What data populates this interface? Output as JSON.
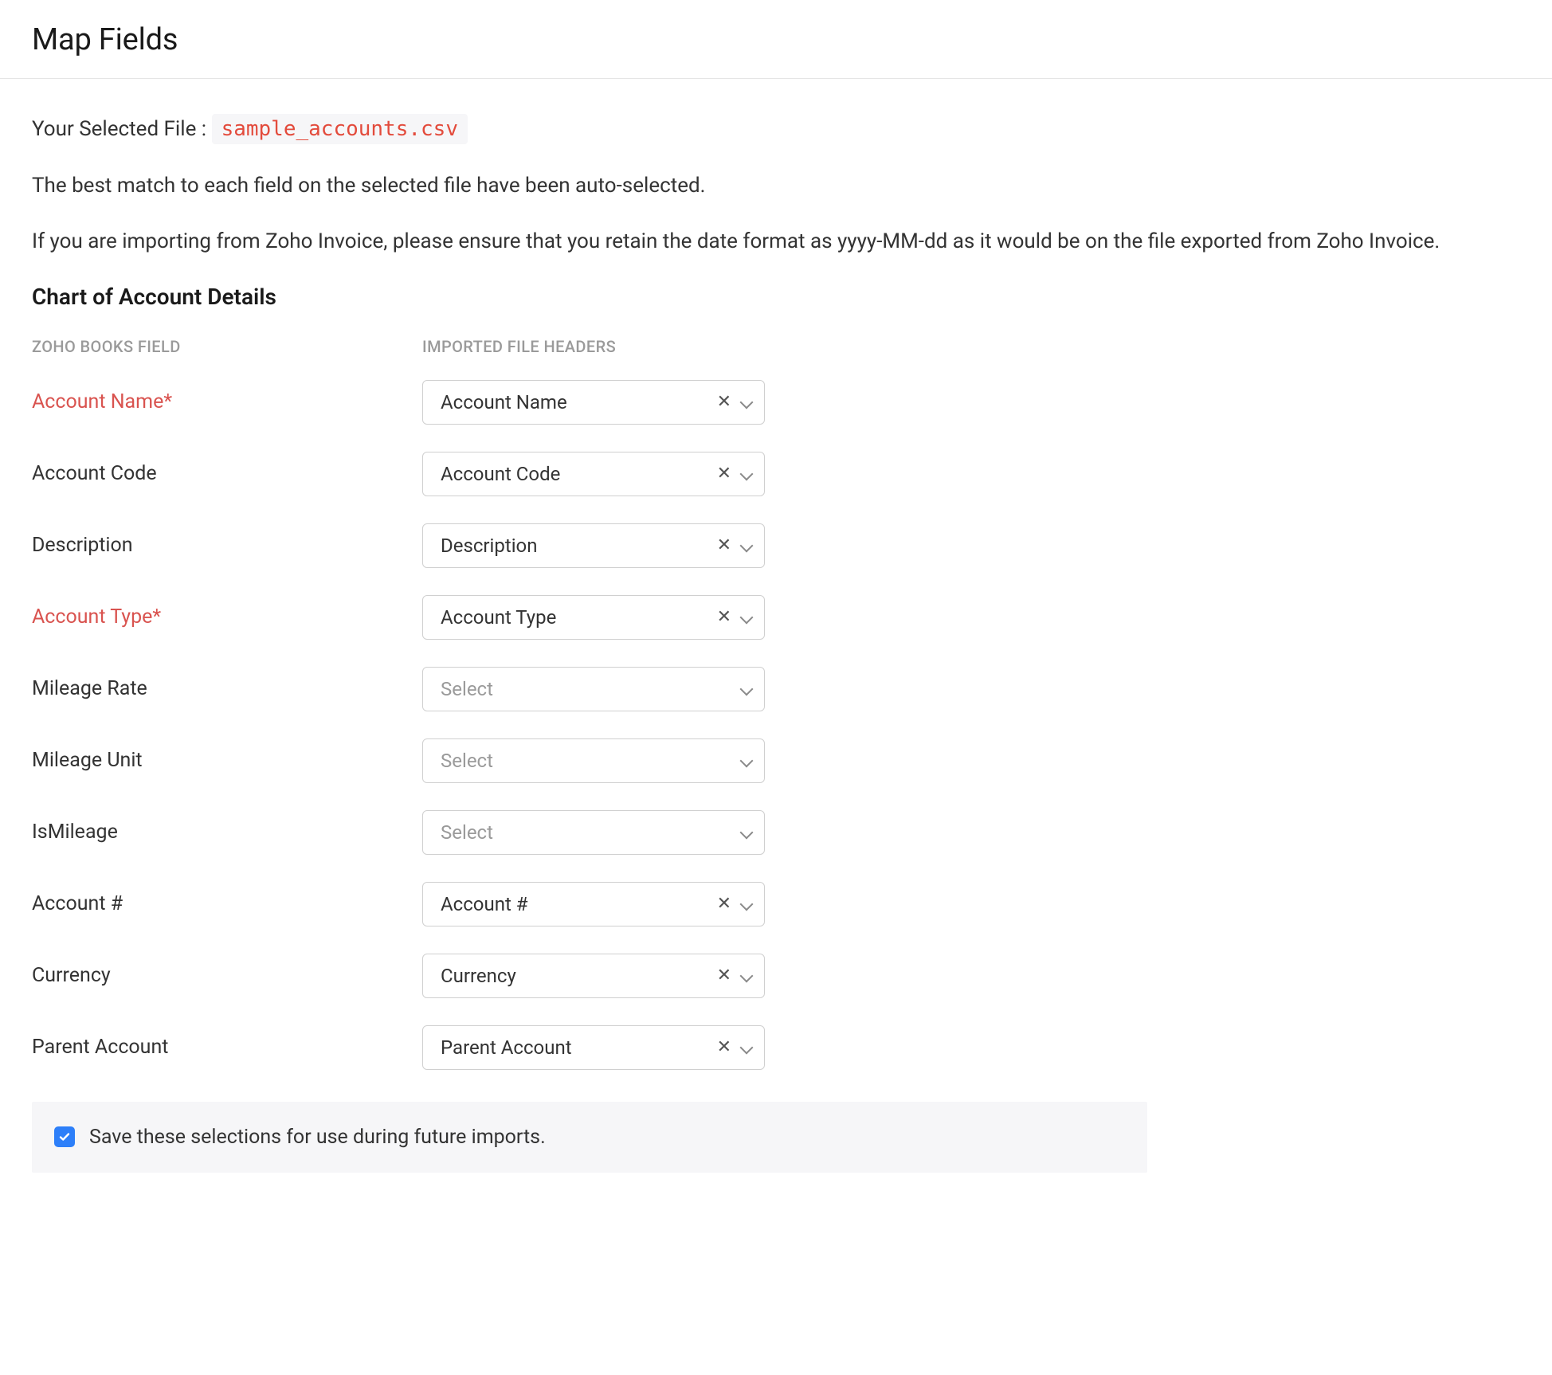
{
  "header": {
    "title": "Map Fields"
  },
  "file": {
    "prefix": "Your Selected File : ",
    "name": "sample_accounts.csv"
  },
  "intro": {
    "auto_match": "The best match to each field on the selected file have been auto-selected.",
    "zoho_invoice_note": "If you are importing from Zoho Invoice, please ensure that you retain the date format as yyyy-MM-dd as it would be on the file exported from Zoho Invoice."
  },
  "section_title": "Chart of Account Details",
  "columns": {
    "left": "ZOHO BOOKS FIELD",
    "right": "IMPORTED FILE HEADERS"
  },
  "placeholder": "Select",
  "rows": [
    {
      "label": "Account Name*",
      "required": true,
      "value": "Account Name",
      "clearable": true
    },
    {
      "label": "Account Code",
      "required": false,
      "value": "Account Code",
      "clearable": true
    },
    {
      "label": "Description",
      "required": false,
      "value": "Description",
      "clearable": true
    },
    {
      "label": "Account Type*",
      "required": true,
      "value": "Account Type",
      "clearable": true
    },
    {
      "label": "Mileage Rate",
      "required": false,
      "value": "",
      "clearable": false
    },
    {
      "label": "Mileage Unit",
      "required": false,
      "value": "",
      "clearable": false
    },
    {
      "label": "IsMileage",
      "required": false,
      "value": "",
      "clearable": false
    },
    {
      "label": "Account #",
      "required": false,
      "value": "Account #",
      "clearable": true
    },
    {
      "label": "Currency",
      "required": false,
      "value": "Currency",
      "clearable": true
    },
    {
      "label": "Parent Account",
      "required": false,
      "value": "Parent Account",
      "clearable": true
    }
  ],
  "save": {
    "checked": true,
    "label": "Save these selections for use during future imports."
  }
}
